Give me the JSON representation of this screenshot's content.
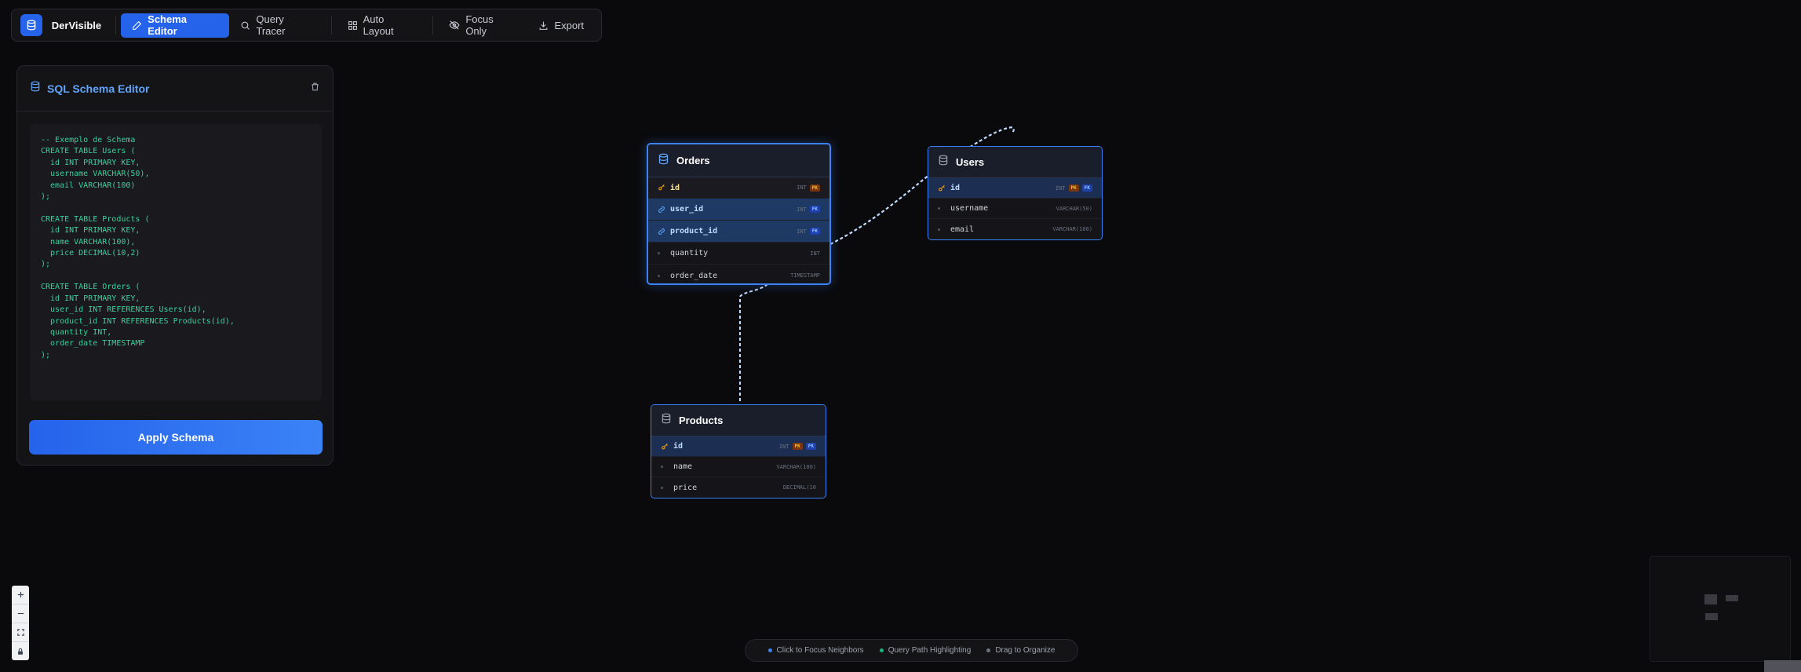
{
  "app": {
    "name": "DerVisible"
  },
  "toolbar": {
    "schema_editor": "Schema Editor",
    "query_tracer": "Query Tracer",
    "auto_layout": "Auto Layout",
    "focus_only": "Focus Only",
    "export": "Export"
  },
  "editor": {
    "title": "SQL Schema Editor",
    "code": "-- Exemplo de Schema\nCREATE TABLE Users (\n  id INT PRIMARY KEY,\n  username VARCHAR(50),\n  email VARCHAR(100)\n);\n\nCREATE TABLE Products (\n  id INT PRIMARY KEY,\n  name VARCHAR(100),\n  price DECIMAL(10,2)\n);\n\nCREATE TABLE Orders (\n  id INT PRIMARY KEY,\n  user_id INT REFERENCES Users(id),\n  product_id INT REFERENCES Products(id),\n  quantity INT,\n  order_date TIMESTAMP\n);",
    "apply_label": "Apply Schema"
  },
  "tables": {
    "orders": {
      "name": "Orders",
      "fields": [
        {
          "name": "id",
          "type": "INT",
          "badges": [
            "PK"
          ]
        },
        {
          "name": "user_id",
          "type": "INT",
          "badges": [
            "FK"
          ]
        },
        {
          "name": "product_id",
          "type": "INT",
          "badges": [
            "FK"
          ]
        },
        {
          "name": "quantity",
          "type": "INT",
          "badges": []
        },
        {
          "name": "order_date",
          "type": "TIMESTAMP",
          "badges": []
        }
      ]
    },
    "users": {
      "name": "Users",
      "fields": [
        {
          "name": "id",
          "type": "INT",
          "badges": [
            "PK",
            "FK"
          ]
        },
        {
          "name": "username",
          "type": "VARCHAR(50)",
          "badges": []
        },
        {
          "name": "email",
          "type": "VARCHAR(100)",
          "badges": []
        }
      ]
    },
    "products": {
      "name": "Products",
      "fields": [
        {
          "name": "id",
          "type": "INT",
          "badges": [
            "PK",
            "FK"
          ]
        },
        {
          "name": "name",
          "type": "VARCHAR(100)",
          "badges": []
        },
        {
          "name": "price",
          "type": "DECIMAL(10",
          "badges": []
        }
      ]
    }
  },
  "legend": {
    "focus": "Click to Focus Neighbors",
    "query": "Query Path Highlighting",
    "drag": "Drag to Organize"
  },
  "colors": {
    "accent": "#2563eb",
    "code_text": "#34d399",
    "pk_badge": "#fbbf24",
    "fk_badge": "#93c5fd",
    "legend_blue": "#3b82f6",
    "legend_green": "#10b981",
    "legend_gray": "#6b7280"
  },
  "icons": [
    "database-icon",
    "pencil-icon",
    "search-icon",
    "grid-icon",
    "eye-off-icon",
    "download-icon",
    "trash-icon",
    "key-icon",
    "link-icon",
    "plus-icon",
    "minus-icon",
    "fit-view-icon",
    "lock-icon"
  ]
}
